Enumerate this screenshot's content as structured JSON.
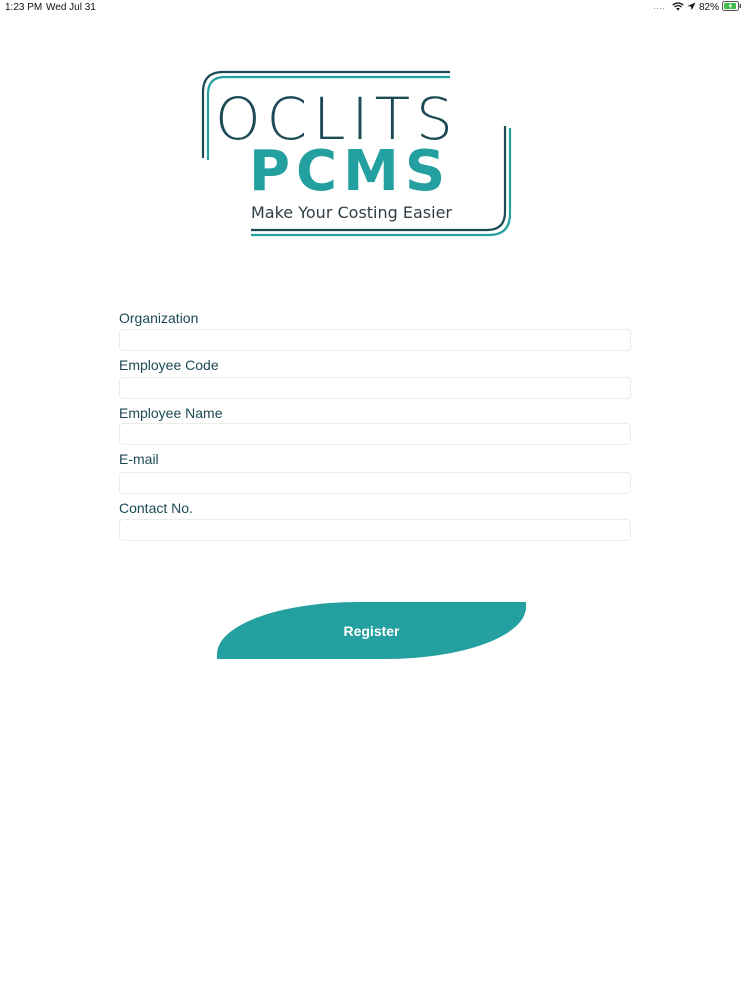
{
  "status_bar": {
    "time": "1:23 PM",
    "date": "Wed Jul 31",
    "battery": "82%"
  },
  "logo": {
    "brand_top": "OCLITS",
    "brand_main": "PCMS",
    "tagline": "Make Your Costing Easier"
  },
  "form": {
    "fields": [
      {
        "label": "Organization",
        "value": ""
      },
      {
        "label": "Employee Code",
        "value": ""
      },
      {
        "label": "Employee Name",
        "value": ""
      },
      {
        "label": "E-mail",
        "value": ""
      },
      {
        "label": "Contact No.",
        "value": ""
      }
    ]
  },
  "register_label": "Register",
  "colors": {
    "accent": "#23a09f",
    "dark_teal": "#1c4a55",
    "label": "#1c4a55"
  },
  "icons": [
    "wifi-icon",
    "location-arrow-icon",
    "battery-charging-icon"
  ]
}
